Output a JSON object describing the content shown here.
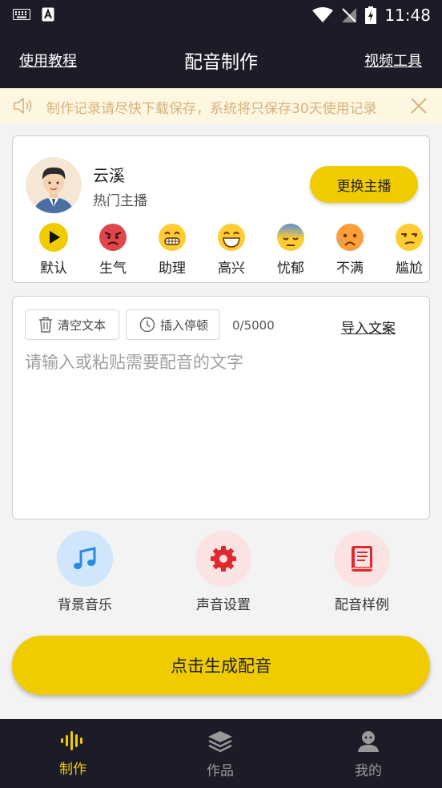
{
  "status_bar": {
    "time": "11:48"
  },
  "header": {
    "left_link": "使用教程",
    "title": "配音制作",
    "right_link": "视频工具"
  },
  "notice": {
    "text": "制作记录请尽快下载保存，系统将只保存30天使用记录"
  },
  "anchor": {
    "name": "云溪",
    "subtitle": "热门主播",
    "switch_label": "更换主播",
    "emotions": [
      {
        "label": "默认",
        "icon": "play-icon"
      },
      {
        "label": "生气",
        "icon": "angry-face-icon"
      },
      {
        "label": "助理",
        "icon": "grin-face-icon"
      },
      {
        "label": "高兴",
        "icon": "happy-face-icon"
      },
      {
        "label": "忧郁",
        "icon": "sweat-face-icon"
      },
      {
        "label": "不满",
        "icon": "worried-face-icon"
      },
      {
        "label": "尴尬",
        "icon": "unamused-face-icon"
      }
    ]
  },
  "editor": {
    "clear_label": "清空文本",
    "pause_label": "插入停顿",
    "counter": "0/5000",
    "import_label": "导入文案",
    "placeholder": "请输入或粘贴需要配音的文字"
  },
  "tools": [
    {
      "label": "背景音乐",
      "icon": "music-note-icon"
    },
    {
      "label": "声音设置",
      "icon": "gear-icon"
    },
    {
      "label": "配音样例",
      "icon": "book-icon"
    }
  ],
  "generate_label": "点击生成配音",
  "nav": [
    {
      "label": "制作",
      "icon": "sound-wave-icon",
      "active": true
    },
    {
      "label": "作品",
      "icon": "layers-icon",
      "active": false
    },
    {
      "label": "我的",
      "icon": "user-icon",
      "active": false
    }
  ],
  "colors": {
    "accent": "#f0cb00",
    "dark": "#1c1c28",
    "notice_bg": "#fdf6e0"
  }
}
